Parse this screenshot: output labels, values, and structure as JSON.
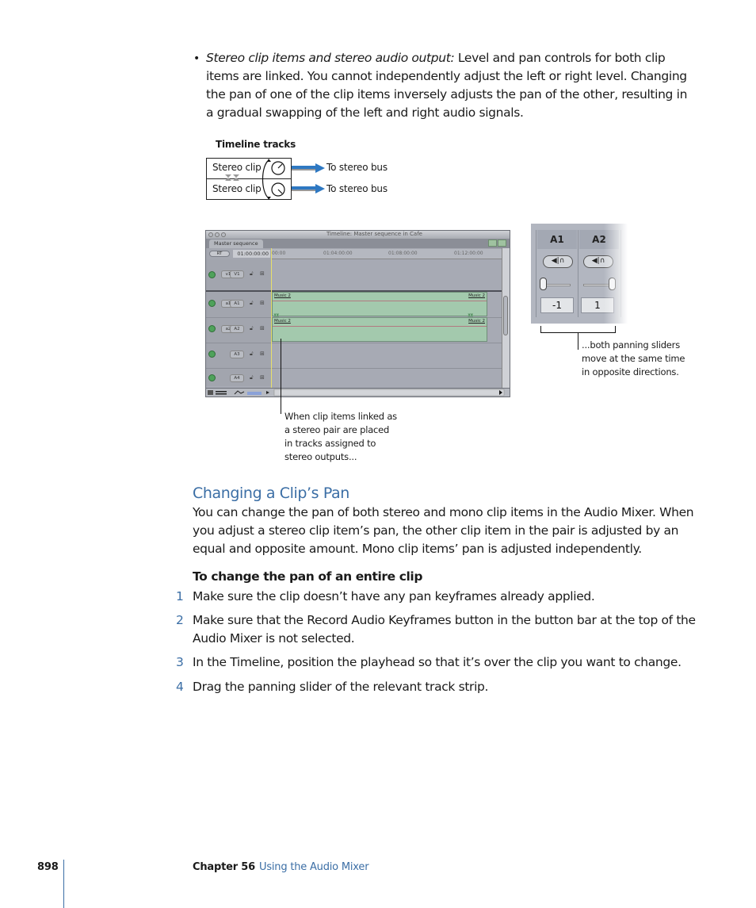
{
  "bullet": {
    "lead_italic": "Stereo clip items and stereo audio output:",
    "text": " Level and pan controls for both clip items are linked. You cannot independently adjust the left or right level. Changing the pan of one of the clip items inversely adjusts the pan of the other, resulting in a gradual swapping of the left and right audio signals."
  },
  "diagram": {
    "title": "Timeline tracks",
    "tracks": [
      {
        "label": "Stereo clip",
        "output": "To stereo bus"
      },
      {
        "label": "Stereo clip",
        "output": "To stereo bus"
      }
    ]
  },
  "timeline_screenshot": {
    "window_title": "Timeline: Master sequence in Cafe",
    "tab": "Master sequence",
    "rt_button": "RT",
    "timecode": "01:00:00:00",
    "ruler_ticks": [
      "00:00",
      "01:04:00:00",
      "01:08:00:00",
      "01:12:00:00"
    ],
    "tracks": [
      {
        "source": "v1",
        "destination": "V1"
      },
      {
        "source": "a1",
        "destination": "A1"
      },
      {
        "source": "a2",
        "destination": "A2"
      },
      {
        "source": "",
        "destination": "A3"
      },
      {
        "source": "",
        "destination": "A4"
      }
    ],
    "clips": [
      {
        "track": "A1",
        "name_start": "Music 2",
        "name_end": "Music 2"
      },
      {
        "track": "A2",
        "name_start": "Music 2",
        "name_end": "Music 2"
      }
    ]
  },
  "mixer_screenshot": {
    "strips": [
      {
        "label": "A1",
        "pan_value": "-1",
        "pan_position": -1
      },
      {
        "label": "A2",
        "pan_value": "1",
        "pan_position": 1
      }
    ]
  },
  "callouts": {
    "timeline": "When clip items linked as a stereo pair are placed in tracks assigned to stereo outputs...",
    "mixer": "...both panning sliders move at the same time in opposite directions."
  },
  "section": {
    "heading": "Changing a Clip’s Pan",
    "intro": "You can change the pan of both stereo and mono clip items in the Audio Mixer. When you adjust a stereo clip item’s pan, the other clip item in the pair is adjusted by an equal and opposite amount. Mono clip items’ pan is adjusted independently.",
    "task_heading": "To change the pan of an entire clip",
    "steps": [
      {
        "num": "1",
        "text": "Make sure the clip doesn’t have any pan keyframes already applied."
      },
      {
        "num": "2",
        "text": "Make sure that the Record Audio Keyframes button in the button bar at the top of the Audio Mixer is not selected."
      },
      {
        "num": "3",
        "text": "In the Timeline, position the playhead so that it’s over the clip you want to change."
      },
      {
        "num": "4",
        "text": "Drag the panning slider of the relevant track strip."
      }
    ]
  },
  "footer": {
    "page_number": "898",
    "chapter": "Chapter 56",
    "chapter_title": "Using the Audio Mixer"
  },
  "colors": {
    "accent_blue": "#3b6ea5",
    "clip_green": "#a3c9ad"
  }
}
